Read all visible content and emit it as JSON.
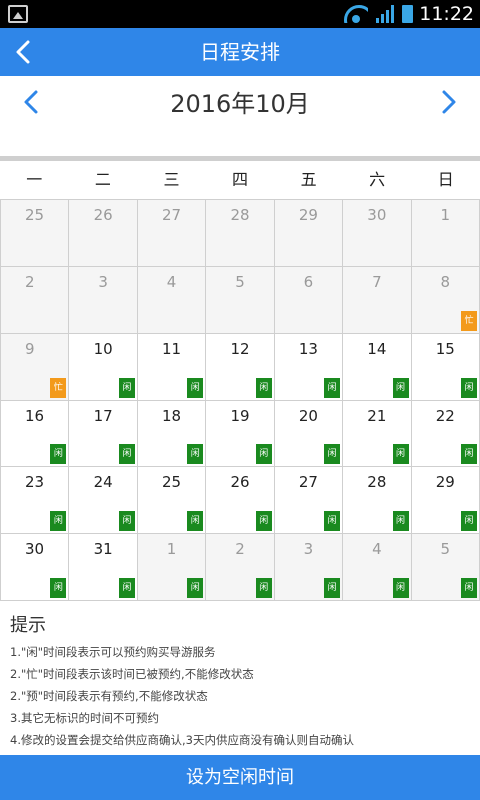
{
  "status_bar": {
    "time": "11:22"
  },
  "appbar": {
    "title": "日程安排"
  },
  "calendar": {
    "month_label": "2016年10月",
    "weekdays": [
      "一",
      "二",
      "三",
      "四",
      "五",
      "六",
      "日"
    ],
    "weeks": [
      [
        {
          "day": "25",
          "other": true,
          "tag": ""
        },
        {
          "day": "26",
          "other": true,
          "tag": ""
        },
        {
          "day": "27",
          "other": true,
          "tag": ""
        },
        {
          "day": "28",
          "other": true,
          "tag": ""
        },
        {
          "day": "29",
          "other": true,
          "tag": ""
        },
        {
          "day": "30",
          "other": true,
          "tag": ""
        },
        {
          "day": "1",
          "other": true,
          "tag": ""
        }
      ],
      [
        {
          "day": "2",
          "other": true,
          "tag": ""
        },
        {
          "day": "3",
          "other": true,
          "tag": ""
        },
        {
          "day": "4",
          "other": true,
          "tag": ""
        },
        {
          "day": "5",
          "other": true,
          "tag": ""
        },
        {
          "day": "6",
          "other": true,
          "tag": ""
        },
        {
          "day": "7",
          "other": true,
          "tag": ""
        },
        {
          "day": "8",
          "other": true,
          "tag": "忙"
        }
      ],
      [
        {
          "day": "9",
          "other": true,
          "tag": "忙"
        },
        {
          "day": "10",
          "other": false,
          "tag": "闲"
        },
        {
          "day": "11",
          "other": false,
          "tag": "闲"
        },
        {
          "day": "12",
          "other": false,
          "tag": "闲"
        },
        {
          "day": "13",
          "other": false,
          "tag": "闲"
        },
        {
          "day": "14",
          "other": false,
          "tag": "闲"
        },
        {
          "day": "15",
          "other": false,
          "tag": "闲"
        }
      ],
      [
        {
          "day": "16",
          "other": false,
          "tag": "闲"
        },
        {
          "day": "17",
          "other": false,
          "tag": "闲"
        },
        {
          "day": "18",
          "other": false,
          "tag": "闲"
        },
        {
          "day": "19",
          "other": false,
          "tag": "闲"
        },
        {
          "day": "20",
          "other": false,
          "tag": "闲"
        },
        {
          "day": "21",
          "other": false,
          "tag": "闲"
        },
        {
          "day": "22",
          "other": false,
          "tag": "闲"
        }
      ],
      [
        {
          "day": "23",
          "other": false,
          "tag": "闲"
        },
        {
          "day": "24",
          "other": false,
          "tag": "闲"
        },
        {
          "day": "25",
          "other": false,
          "tag": "闲"
        },
        {
          "day": "26",
          "other": false,
          "tag": "闲"
        },
        {
          "day": "27",
          "other": false,
          "tag": "闲"
        },
        {
          "day": "28",
          "other": false,
          "tag": "闲"
        },
        {
          "day": "29",
          "other": false,
          "tag": "闲"
        }
      ],
      [
        {
          "day": "30",
          "other": false,
          "tag": "闲"
        },
        {
          "day": "31",
          "other": false,
          "tag": "闲"
        },
        {
          "day": "1",
          "other": true,
          "tag": "闲"
        },
        {
          "day": "2",
          "other": true,
          "tag": "闲"
        },
        {
          "day": "3",
          "other": true,
          "tag": "闲"
        },
        {
          "day": "4",
          "other": true,
          "tag": "闲"
        },
        {
          "day": "5",
          "other": true,
          "tag": "闲"
        }
      ]
    ]
  },
  "tips": {
    "heading": "提示",
    "lines": [
      "1.\"闲\"时间段表示可以预约购买导游服务",
      "2.\"忙\"时间段表示该时间已被预约,不能修改状态",
      "2.\"预\"时间段表示有预约,不能修改状态",
      "3.其它无标识的时间不可预约",
      "4.修改的设置会提交给供应商确认,3天内供应商没有确认则自动确认"
    ]
  },
  "action_button": {
    "label": "设为空闲时间"
  },
  "colors": {
    "primary": "#2f86e8",
    "free_tag": "#1a8a1f",
    "busy_tag": "#f39a1b"
  },
  "icons": {
    "back": "chevron-left-icon",
    "prev": "chevron-left-icon",
    "next": "chevron-right-icon"
  }
}
